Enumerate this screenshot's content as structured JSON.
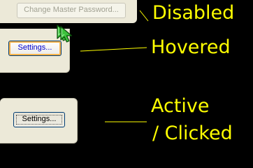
{
  "buttons": {
    "disabled": {
      "label": "Change Master Password...",
      "state": "disabled"
    },
    "hovered": {
      "label": "Settings...",
      "state": "hovered"
    },
    "active": {
      "label": "Settings...",
      "state": "active"
    }
  },
  "captions": {
    "disabled": "Disabled",
    "hovered": "Hovered",
    "active_line1": "Active",
    "active_line2": "/ Clicked"
  },
  "icons": {
    "cursor": "pointer-arrow-icon"
  },
  "colors": {
    "background": "#000000",
    "caption_text": "#ffff00",
    "panel": "#ece9d8",
    "cursor_fill": "#3dc23d",
    "disabled_text": "#a1a192",
    "hover_text": "#0000cc",
    "hover_glow": "#f9b34b",
    "button_border": "#003c74"
  }
}
